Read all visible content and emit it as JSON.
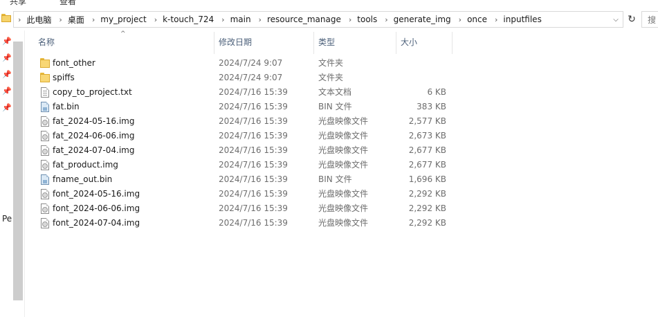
{
  "ribbon": {
    "tab_view": "共享",
    "tab_share": "查看"
  },
  "address": {
    "breadcrumbs": [
      "此电脑",
      "桌面",
      "my_project",
      "k-touch_724",
      "main",
      "resource_manage",
      "tools",
      "generate_img",
      "once",
      "inputfiles"
    ],
    "refresh_glyph": "↻",
    "dropdown_glyph": "⌵",
    "search_hint": "搜"
  },
  "nav": {
    "partial_label": "Pe"
  },
  "columns": {
    "name": "名称",
    "date": "修改日期",
    "type": "类型",
    "size": "大小"
  },
  "files": [
    {
      "icon": "folder",
      "name": "font_other",
      "date": "2024/7/24 9:07",
      "type": "文件夹",
      "size": ""
    },
    {
      "icon": "folder",
      "name": "spiffs",
      "date": "2024/7/24 9:07",
      "type": "文件夹",
      "size": ""
    },
    {
      "icon": "text",
      "name": "copy_to_project.txt",
      "date": "2024/7/16 15:39",
      "type": "文本文档",
      "size": "6 KB"
    },
    {
      "icon": "bin",
      "name": "fat.bin",
      "date": "2024/7/16 15:39",
      "type": "BIN 文件",
      "size": "383 KB"
    },
    {
      "icon": "disc-image",
      "name": "fat_2024-05-16.img",
      "date": "2024/7/16 15:39",
      "type": "光盘映像文件",
      "size": "2,577 KB"
    },
    {
      "icon": "disc-image",
      "name": "fat_2024-06-06.img",
      "date": "2024/7/16 15:39",
      "type": "光盘映像文件",
      "size": "2,673 KB"
    },
    {
      "icon": "disc-image",
      "name": "fat_2024-07-04.img",
      "date": "2024/7/16 15:39",
      "type": "光盘映像文件",
      "size": "2,677 KB"
    },
    {
      "icon": "disc-image",
      "name": "fat_product.img",
      "date": "2024/7/16 15:39",
      "type": "光盘映像文件",
      "size": "2,677 KB"
    },
    {
      "icon": "bin",
      "name": "fname_out.bin",
      "date": "2024/7/16 15:39",
      "type": "BIN 文件",
      "size": "1,696 KB"
    },
    {
      "icon": "disc-image",
      "name": "font_2024-05-16.img",
      "date": "2024/7/16 15:39",
      "type": "光盘映像文件",
      "size": "2,292 KB"
    },
    {
      "icon": "disc-image",
      "name": "font_2024-06-06.img",
      "date": "2024/7/16 15:39",
      "type": "光盘映像文件",
      "size": "2,292 KB"
    },
    {
      "icon": "disc-image",
      "name": "font_2024-07-04.img",
      "date": "2024/7/16 15:39",
      "type": "光盘映像文件",
      "size": "2,292 KB"
    }
  ]
}
